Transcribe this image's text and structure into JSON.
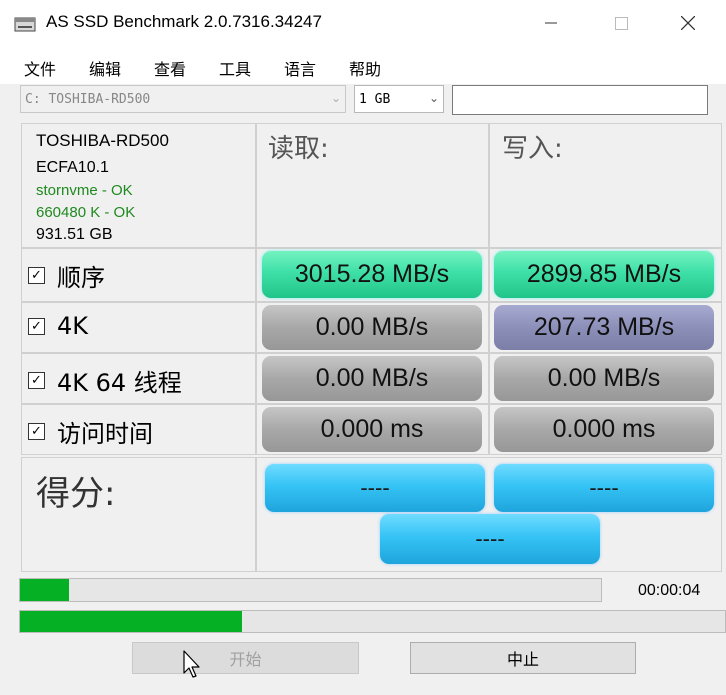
{
  "window": {
    "title": "AS SSD Benchmark 2.0.7316.34247"
  },
  "menu": [
    "文件",
    "编辑",
    "查看",
    "工具",
    "语言",
    "帮助"
  ],
  "controls": {
    "drive": "C: TOSHIBA-RD500",
    "size": "1 GB",
    "text_value": ""
  },
  "drive_info": {
    "model": "TOSHIBA-RD500",
    "firmware": "ECFA10.1",
    "driver": "stornvme - OK",
    "alignment": "660480 K - OK",
    "capacity": "931.51 GB"
  },
  "columns": {
    "read": "读取:",
    "write": "写入:"
  },
  "tests": [
    {
      "label": "顺序",
      "checked": true,
      "read": "3015.28 MB/s",
      "write": "2899.85 MB/s"
    },
    {
      "label": "4K",
      "checked": true,
      "read": "0.00 MB/s",
      "write": "207.73 MB/s"
    },
    {
      "label": "4K 64 线程",
      "checked": true,
      "read": "0.00 MB/s",
      "write": "0.00 MB/s"
    },
    {
      "label": "访问时间",
      "checked": true,
      "read": "0.000 ms",
      "write": "0.000 ms"
    }
  ],
  "score": {
    "label": "得分:",
    "read": "----",
    "write": "----",
    "total": "----"
  },
  "progress": {
    "bar1": 0.085,
    "bar2": 0.315,
    "elapsed": "00:00:04"
  },
  "buttons": {
    "start": "开始",
    "stop": "中止"
  },
  "colors": {
    "green_result": "#3fe0a8",
    "gray_result": "#a8a8a8",
    "slate_result": "#8c8fb8",
    "score_blue": "#36c3f5",
    "progress_green": "#06b025"
  },
  "icons": {
    "app": "drive-icon",
    "checkbox": "check-icon",
    "dropdown": "chevron-down-icon"
  }
}
